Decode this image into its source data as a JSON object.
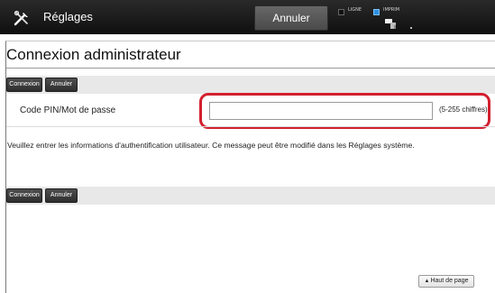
{
  "header": {
    "title": "Réglages",
    "cancel_label": "Annuler",
    "status_ligne": "LIGNE",
    "status_imprim": "IMPRIM"
  },
  "page": {
    "title": "Connexion administrateur"
  },
  "actions_top": {
    "connect_label": "Connexion",
    "cancel_label": "Annuler"
  },
  "form": {
    "pin_label": "Code PIN/Mot de passe",
    "pin_value": "",
    "pin_hint": "(5-255 chiffres)"
  },
  "info": {
    "message": "Veuillez entrer les informations d'authentification utilisateur. Ce message peut être modifié dans les Réglages système."
  },
  "actions_bottom": {
    "connect_label": "Connexion",
    "cancel_label": "Annuler"
  },
  "footer": {
    "back_to_top_label": "Haut de page"
  },
  "colors": {
    "header_bg": "#161616",
    "highlight": "#d3202f",
    "imprim_indicator": "#2f8fe0"
  },
  "icons": [
    "tools-icon",
    "printer-icon",
    "up-arrow-icon"
  ]
}
